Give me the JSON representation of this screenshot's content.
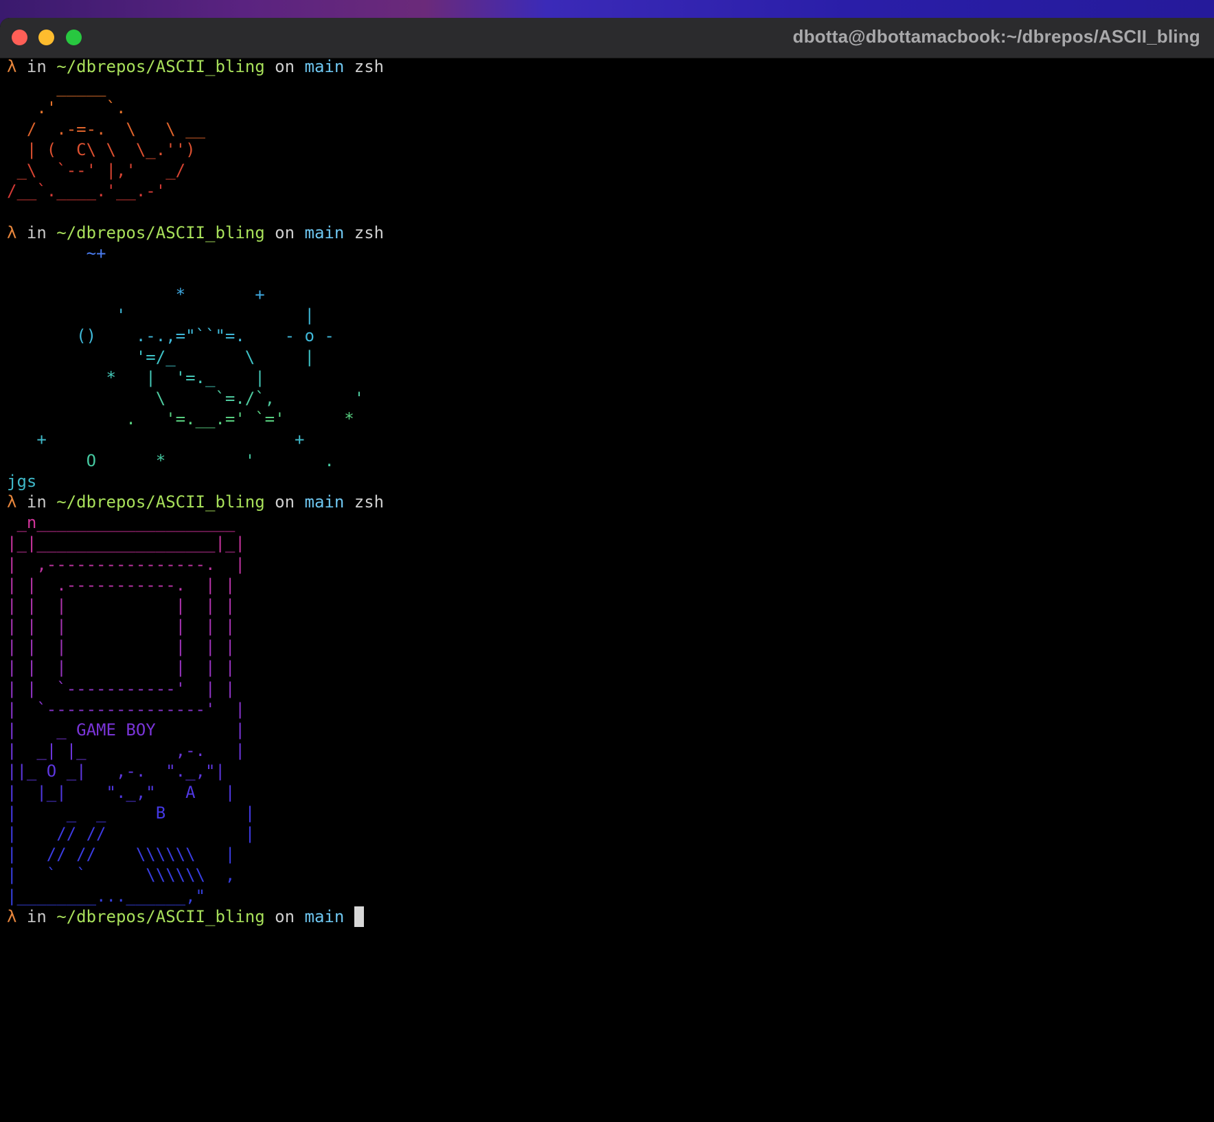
{
  "window": {
    "title": "dbotta@dbottamacbook:~/dbrepos/ASCII_bling"
  },
  "prompt": {
    "lambda": "λ",
    "in": "in",
    "path": "~/dbrepos/ASCII_bling",
    "on": "on",
    "branch": "main",
    "shell": "zsh"
  },
  "colors": {
    "lambda": "#e8863c",
    "prompt_word": "#c9c9c9",
    "path": "#a8e05a",
    "on": "#d0d0d0",
    "branch": "#6ec6f0",
    "shell": "#d0d0d0",
    "ascii_orange": "#e0642c",
    "ascii_red": "#d83a36",
    "ascii_cyan": "#3fb8d8",
    "ascii_green": "#5fd36a",
    "ascii_blue": "#4a7cf0",
    "ascii_magenta": "#c03aa0",
    "ascii_purple": "#7a35d8",
    "ascii_indigo": "#3d3ae0",
    "cursor": "#d8d8d8"
  },
  "blocks": [
    {
      "type": "ascii",
      "name": "snail-art",
      "lines": [
        {
          "text": "     _____",
          "color": "#e8742c"
        },
        {
          "text": "   .'     `.",
          "color": "#e8742c"
        },
        {
          "text": "  /  .-=-.  \\   \\ __",
          "color": "#e0642c"
        },
        {
          "text": "  | (  C\\ \\  \\_.'')",
          "color": "#dc5030"
        },
        {
          "text": " _\\  `--' |,'   _/",
          "color": "#d84432"
        },
        {
          "text": "/__`.____.'__.-'",
          "color": "#d43a36"
        }
      ]
    },
    {
      "type": "ascii",
      "name": "planet-art",
      "lines": [
        {
          "text": "        ~+",
          "color": "#4a7cf0"
        },
        {
          "text": "",
          "color": "#4a7cf0"
        },
        {
          "text": "                 *       +",
          "color": "#3fa8e0"
        },
        {
          "text": "           '                  |",
          "color": "#3fb8d8"
        },
        {
          "text": "       ()    .-.,=\"``\"=.    - o -",
          "color": "#3fb8d8"
        },
        {
          "text": "             '=/_       \\     |",
          "color": "#3fc4c8"
        },
        {
          "text": "          *   |  '=._    |",
          "color": "#45c8b8"
        },
        {
          "text": "               \\     `=./`,        '",
          "color": "#4fcca0"
        },
        {
          "text": "            .   '=.__.=' `='      *",
          "color": "#58d080"
        },
        {
          "text": "   +                         +",
          "color": "#3fb8c8"
        },
        {
          "text": "        O      *        '       .",
          "color": "#45c8a0"
        },
        {
          "text": "jgs",
          "color": "#3fb8c8"
        }
      ]
    },
    {
      "type": "ascii",
      "name": "gameboy-art",
      "lines": [
        {
          "text": " _n____________________",
          "color": "#d0349a"
        },
        {
          "text": "|_|__________________|_|",
          "color": "#c8349e"
        },
        {
          "text": "|  ,----------------.  |",
          "color": "#c034a2"
        },
        {
          "text": "| |  .-----------.  | |",
          "color": "#b834a8"
        },
        {
          "text": "| |  |           |  | |",
          "color": "#b034ae"
        },
        {
          "text": "| |  |           |  | |",
          "color": "#a834b4"
        },
        {
          "text": "| |  |           |  | |",
          "color": "#a034ba"
        },
        {
          "text": "| |  |           |  | |",
          "color": "#9834c0"
        },
        {
          "text": "| |  `-----------'  | |",
          "color": "#9034c6"
        },
        {
          "text": "|  `----------------'  |",
          "color": "#8834cc"
        },
        {
          "text": "|    _ GAME BOY        |",
          "color": "#7a35d8"
        },
        {
          "text": "|  _| |_         ,-.   |",
          "color": "#6c36dc"
        },
        {
          "text": "||_ O _|   ,-.  \"._,\"|",
          "color": "#5e37e0"
        },
        {
          "text": "|  |_|    \"._,\"   A   |",
          "color": "#5038e2"
        },
        {
          "text": "|     _  _     B        |",
          "color": "#4439e4"
        },
        {
          "text": "|    // //              |",
          "color": "#3d3ae0"
        },
        {
          "text": "|   // //    \\\\\\\\\\\\   |",
          "color": "#3a3ce0"
        },
        {
          "text": "|   `  `      \\\\\\\\\\\\  ,",
          "color": "#383ee0"
        },
        {
          "text": "|________...______,\"",
          "color": "#3640de"
        }
      ]
    }
  ]
}
